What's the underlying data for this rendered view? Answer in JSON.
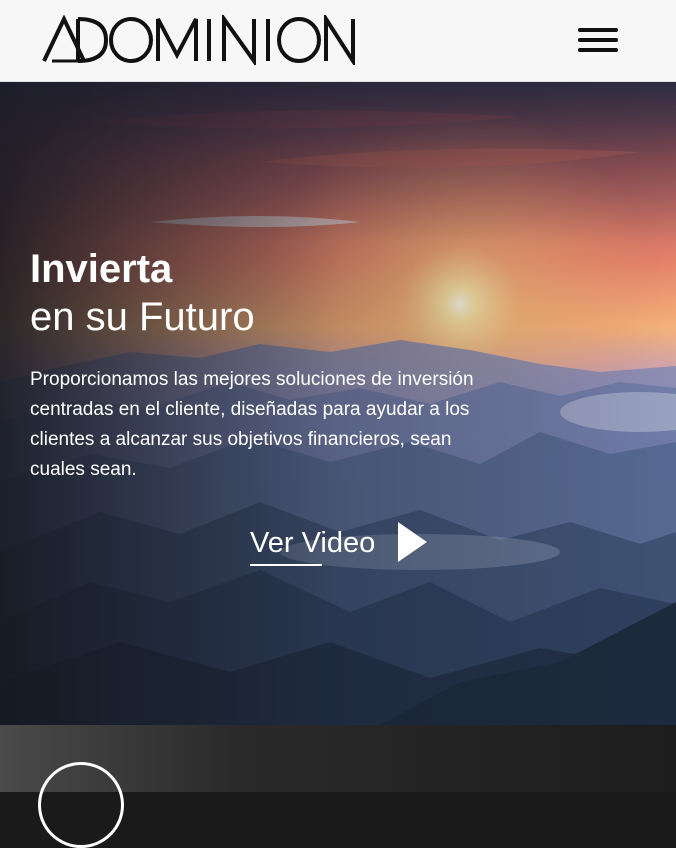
{
  "header": {
    "logo_alt": "DOMINION",
    "menu_icon": "hamburger-menu-icon"
  },
  "hero": {
    "title": "Invierta",
    "subtitle": "en su Futuro",
    "description": "Proporcionamos las mejores soluciones de inversión centradas en el cliente, diseñadas para ayudar a los clientes a alcanzar sus objetivos financieros, sean cuales sean.",
    "video_label": "Ver Video",
    "video_icon": "play-icon"
  },
  "colors": {
    "header_bg": "#f7f7f7",
    "text_light": "#ffffff",
    "logo": "#111111"
  }
}
